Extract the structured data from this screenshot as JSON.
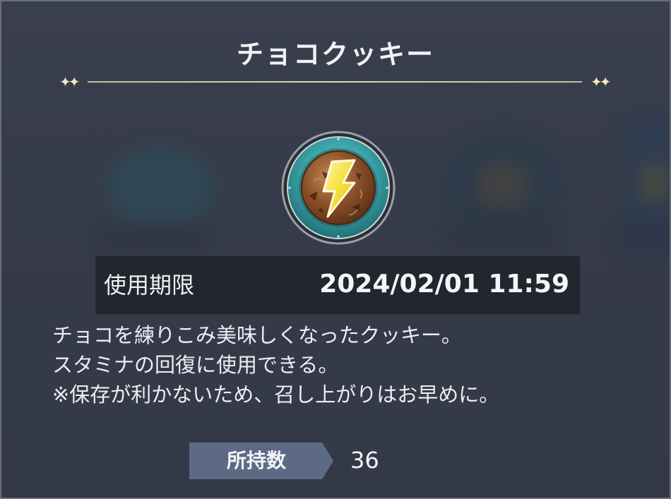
{
  "item": {
    "name": "チョコクッキー",
    "icon": "lightning-cookie-icon"
  },
  "expiry": {
    "label": "使用期限",
    "value": "2024/02/01 11:59"
  },
  "description": {
    "lines": [
      "チョコを練りこみ美味しくなったクッキー。",
      "スタミナの回復に使用できる。",
      "※保存が利かないため、召し上がりはお早めに。"
    ]
  },
  "owned": {
    "label": "所持数",
    "value": "36"
  },
  "colors": {
    "panel_bg": "#363b49",
    "expiry_bar_bg": "#22262f",
    "tag_bg": "#5d6a86",
    "ring_teal": "#3aa1a6",
    "bolt_yellow": "#f6df3a",
    "cookie_brown": "#8a4f28"
  }
}
